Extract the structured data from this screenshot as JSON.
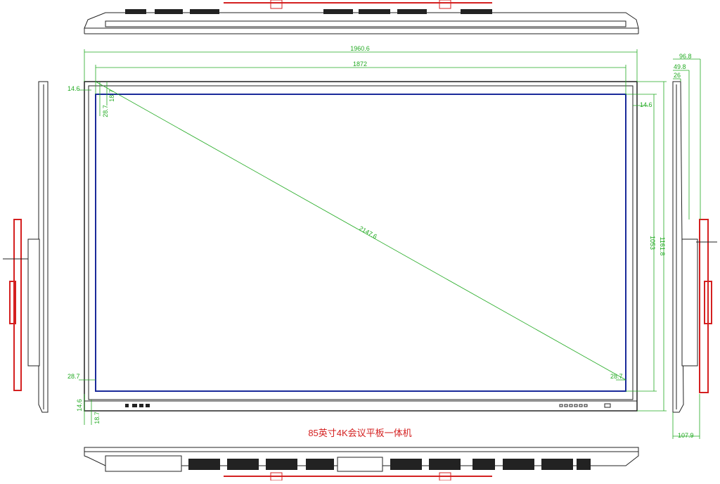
{
  "caption": "85英寸4K会议平板一体机",
  "dimensions": {
    "overall_width": "1960.6",
    "screen_width": "1872",
    "diagonal": "2147.6",
    "screen_height": "1053",
    "overall_height": "1161.8",
    "bezel_top": "14.6",
    "bezel_top_inner": "28.7",
    "bezel_top_offset": "18.7",
    "bezel_right": "14.6",
    "bezel_left_bottom": "28.7",
    "bezel_right_bottom": "28.7",
    "bezel_bottom": "14.6",
    "bottom_offset": "18.7",
    "depth_total": "96.8",
    "depth_mid": "49.8",
    "depth_min": "26",
    "depth_bottom": "107.9"
  },
  "colors": {
    "dimension_line": "#22aa22",
    "screen_outline": "#1a2a9a",
    "bracket": "#d42020",
    "outline": "#222222"
  }
}
